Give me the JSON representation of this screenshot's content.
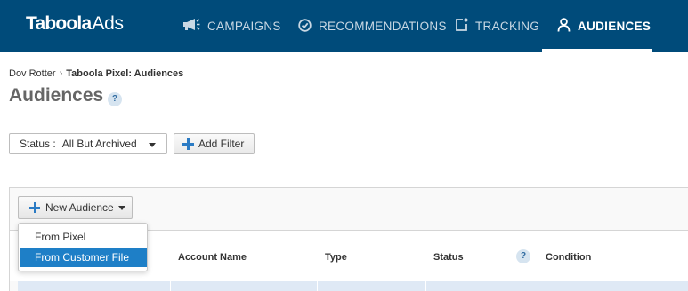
{
  "app": {
    "logo_bold": "Taboola",
    "logo_light": "Ads"
  },
  "nav": {
    "items": [
      {
        "label": "CAMPAIGNS",
        "icon": "megaphone-icon"
      },
      {
        "label": "RECOMMENDATIONS",
        "icon": "check-circle-icon"
      },
      {
        "label": "TRACKING",
        "icon": "tracking-icon"
      },
      {
        "label": "AUDIENCES",
        "icon": "person-icon"
      }
    ],
    "active": "AUDIENCES"
  },
  "breadcrumb": {
    "account": "Dov Rotter",
    "separator": "›",
    "current": "Taboola Pixel: Audiences"
  },
  "page": {
    "title": "Audiences",
    "help": "?"
  },
  "filters": {
    "status_label": "Status :",
    "status_value": "All But Archived",
    "add_filter_label": "Add Filter"
  },
  "toolbar": {
    "new_audience_label": "New Audience"
  },
  "menu": {
    "items": [
      "From Pixel",
      "From Customer File"
    ],
    "highlighted": "From Customer File"
  },
  "table": {
    "columns": [
      "Account Name",
      "Type",
      "Status",
      "Condition"
    ],
    "status_help": "?"
  },
  "colors": {
    "nav_bg": "#004b7a",
    "accent": "#1e7fc7",
    "row_highlight": "#dfe9f5"
  }
}
